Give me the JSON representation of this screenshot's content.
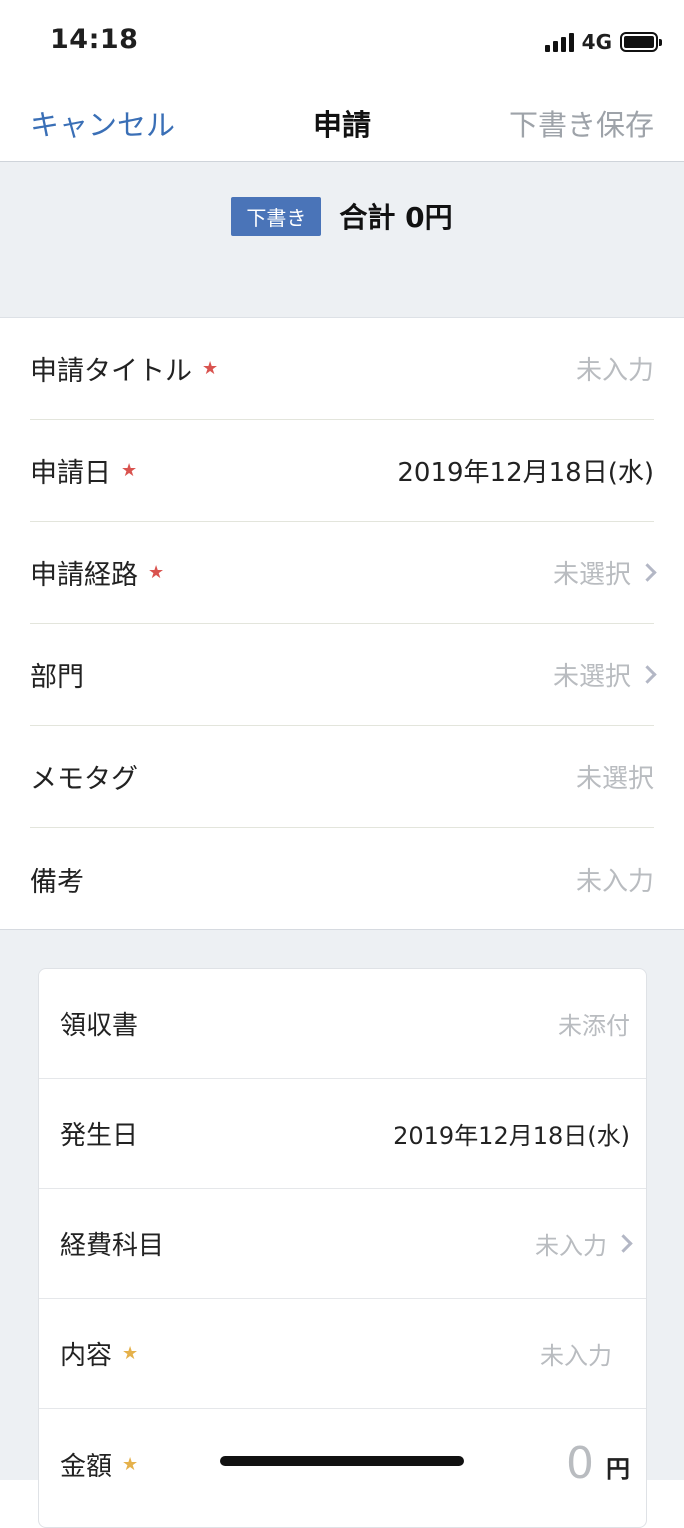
{
  "status_bar": {
    "time": "14:18",
    "network": "4G"
  },
  "nav": {
    "cancel_label": "キャンセル",
    "title": "申請",
    "save_draft_label": "下書き保存"
  },
  "summary": {
    "badge": "下書き",
    "total": "合計 0円"
  },
  "form": {
    "rows": [
      {
        "label": "申請タイトル",
        "required": true,
        "value": "未入力"
      },
      {
        "label": "申請日",
        "required": true,
        "value": "2019年12月18日(水)"
      },
      {
        "label": "申請経路",
        "required": true,
        "value": "未選択"
      },
      {
        "label": "部門",
        "required": false,
        "value": "未選択"
      },
      {
        "label": "メモタグ",
        "required": false,
        "value": "未選択"
      },
      {
        "label": "備考",
        "required": false,
        "value": "未入力"
      }
    ]
  },
  "expense_card": {
    "rows": [
      {
        "label": "領収書",
        "value": "未添付"
      },
      {
        "label": "発生日",
        "value": "2019年12月18日(水)"
      },
      {
        "label": "経費科目",
        "value": "未入力"
      },
      {
        "label": "内容",
        "required": true,
        "value": "未入力"
      },
      {
        "label": "金額",
        "required": true,
        "value": "0",
        "unit": "円"
      }
    ]
  },
  "colors": {
    "accent": "#3a6fb6",
    "badge": "#4a74b8",
    "required_red": "#d9534f",
    "required_gold": "#e5b14b",
    "background_gray": "#edf0f3"
  }
}
